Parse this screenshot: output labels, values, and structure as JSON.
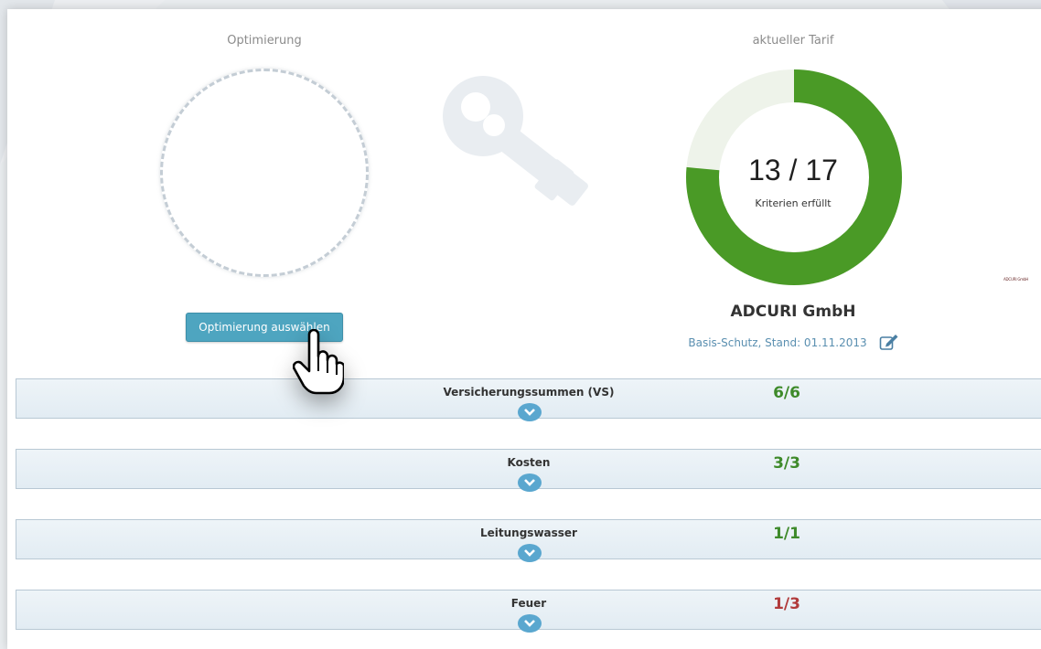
{
  "left_panel": {
    "title": "Optimierung",
    "button_label": "Optimierung auswählen"
  },
  "right_panel": {
    "title": "aktueller Tarif",
    "score_text": "13 / 17",
    "score_label": "Kriterien erfüllt",
    "fulfilled": 13,
    "total": 17,
    "accent_color": "#4a9a26",
    "track_color": "#eef3ea",
    "company": "ADCURI GmbH",
    "tariff": "Basis-Schutz, Stand: 01.11.2013",
    "mini_logo": "ADCURI GmbH"
  },
  "criteria_rows": [
    {
      "label": "Versicherungssummen (VS)",
      "score": "6/6",
      "status": "ok"
    },
    {
      "label": "Kosten",
      "score": "3/3",
      "status": "ok"
    },
    {
      "label": "Leitungswasser",
      "score": "1/1",
      "status": "ok"
    },
    {
      "label": "Feuer",
      "score": "1/3",
      "status": "bad"
    }
  ],
  "colors": {
    "ok": "#3e8a2a",
    "bad": "#b13b3b",
    "button": "#4ea5c0",
    "toggle": "#5aa7cf"
  },
  "icons": [
    "key-icon",
    "edit-icon",
    "chevron-down-icon",
    "hand-cursor-icon"
  ]
}
